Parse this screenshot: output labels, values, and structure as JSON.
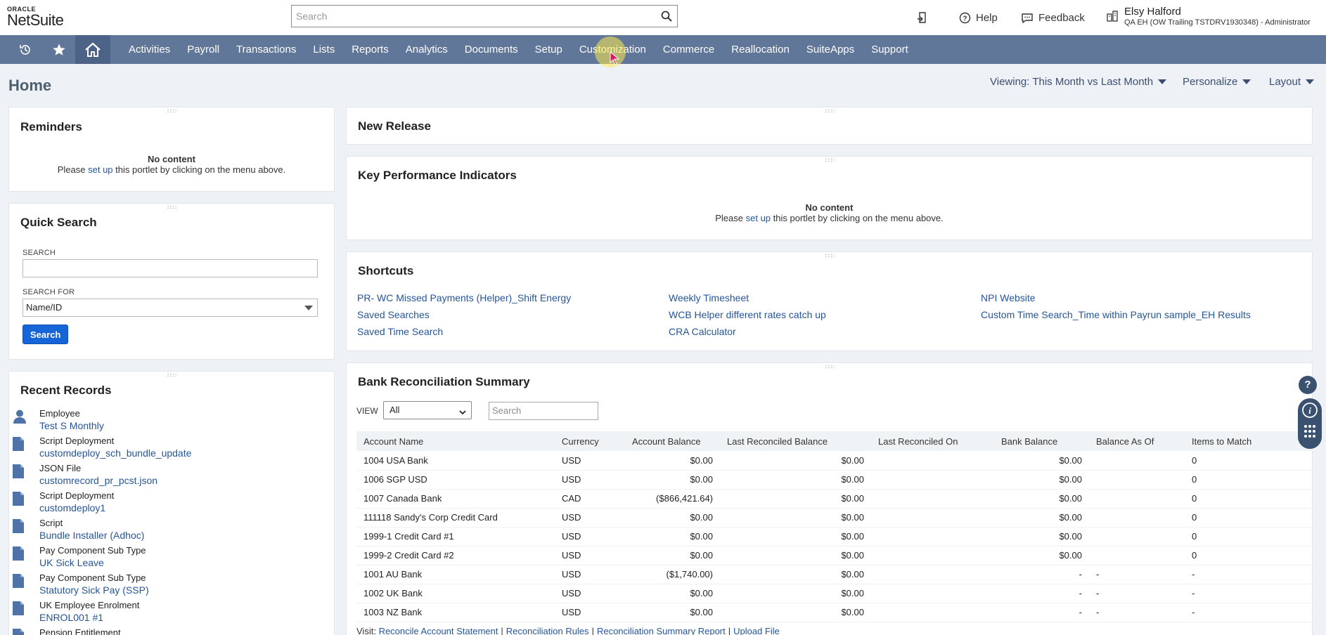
{
  "header": {
    "logo_top": "ORACLE",
    "logo_bottom": "NetSuite",
    "search_placeholder": "Search",
    "help_label": "Help",
    "feedback_label": "Feedback",
    "user_name": "Elsy Halford",
    "user_role": "QA EH (OW Trailing TSTDRV1930348) - Administrator"
  },
  "nav": {
    "items": [
      "Activities",
      "Payroll",
      "Transactions",
      "Lists",
      "Reports",
      "Analytics",
      "Documents",
      "Setup",
      "Customization",
      "Commerce",
      "Reallocation",
      "SuiteApps",
      "Support"
    ]
  },
  "page": {
    "title": "Home",
    "viewing_label": "Viewing: This Month vs Last Month",
    "personalize_label": "Personalize",
    "layout_label": "Layout"
  },
  "reminders": {
    "title": "Reminders",
    "no_content": "No content",
    "setup_pre": "Please ",
    "setup_link": "set up",
    "setup_post": " this portlet by clicking on the menu above."
  },
  "quick_search": {
    "title": "Quick Search",
    "search_label": "SEARCH",
    "search_for_label": "SEARCH FOR",
    "search_for_value": "Name/ID",
    "button_label": "Search"
  },
  "recent_records": {
    "title": "Recent Records",
    "items": [
      {
        "type": "Employee",
        "name": "Test S Monthly",
        "icon": "person-icon"
      },
      {
        "type": "Script Deployment",
        "name": "customdeploy_sch_bundle_update",
        "icon": "document-icon"
      },
      {
        "type": "JSON File",
        "name": "customrecord_pr_pcst.json",
        "icon": "document-icon"
      },
      {
        "type": "Script Deployment",
        "name": "customdeploy1",
        "icon": "document-icon"
      },
      {
        "type": "Script",
        "name": "Bundle Installer (Adhoc)",
        "icon": "document-icon"
      },
      {
        "type": "Pay Component Sub Type",
        "name": "UK Sick Leave",
        "icon": "document-icon"
      },
      {
        "type": "Pay Component Sub Type",
        "name": "Statutory Sick Pay (SSP)",
        "icon": "document-icon"
      },
      {
        "type": "UK Employee Enrolment",
        "name": "ENROL001 #1",
        "icon": "document-icon"
      },
      {
        "type": "Pension Entitlement",
        "name": "",
        "icon": "document-icon"
      }
    ]
  },
  "new_release": {
    "title": "New Release"
  },
  "kpi": {
    "title": "Key Performance Indicators",
    "no_content": "No content",
    "setup_pre": "Please ",
    "setup_link": "set up",
    "setup_post": " this portlet by clicking on the menu above."
  },
  "shortcuts": {
    "title": "Shortcuts",
    "links": [
      "PR- WC Missed Payments (Helper)_Shift Energy",
      "Saved Searches",
      "Saved Time Search",
      "Weekly Timesheet",
      "WCB Helper different rates catch up",
      "CRA Calculator",
      "NPI Website",
      "Custom Time Search_Time within Payrun sample_EH Results"
    ]
  },
  "bank_rec": {
    "title": "Bank Reconciliation Summary",
    "view_label": "VIEW",
    "view_value": "All",
    "search_placeholder": "Search",
    "columns": [
      "Account Name",
      "Currency",
      "Account Balance",
      "Last Reconciled Balance",
      "Last Reconciled On",
      "Bank Balance",
      "Balance As Of",
      "Items to Match"
    ],
    "rows": [
      [
        "1004 USA Bank",
        "USD",
        "$0.00",
        "$0.00",
        "",
        "$0.00",
        "",
        "0"
      ],
      [
        "1006 SGP USD",
        "USD",
        "$0.00",
        "$0.00",
        "",
        "$0.00",
        "",
        "0"
      ],
      [
        "1007 Canada Bank",
        "CAD",
        "($866,421.64)",
        "$0.00",
        "",
        "$0.00",
        "",
        "0"
      ],
      [
        "111118 Sandy's Corp Credit Card",
        "USD",
        "$0.00",
        "$0.00",
        "",
        "$0.00",
        "",
        "0"
      ],
      [
        "1999-1 Credit Card #1",
        "USD",
        "$0.00",
        "$0.00",
        "",
        "$0.00",
        "",
        "0"
      ],
      [
        "1999-2 Credit Card #2",
        "USD",
        "$0.00",
        "$0.00",
        "",
        "$0.00",
        "",
        "0"
      ],
      [
        "1001 AU Bank",
        "USD",
        "($1,740.00)",
        "$0.00",
        "",
        "-",
        "-",
        "-"
      ],
      [
        "1002 UK Bank",
        "USD",
        "$0.00",
        "$0.00",
        "",
        "-",
        "-",
        "-"
      ],
      [
        "1003 NZ Bank",
        "USD",
        "$0.00",
        "$0.00",
        "",
        "-",
        "-",
        "-"
      ]
    ],
    "visit_label": "Visit:",
    "visit_links": [
      "Reconcile Account Statement",
      "Reconciliation Rules",
      "Reconciliation Summary Report",
      "Upload File"
    ]
  },
  "side_widgets": {
    "help_glyph": "?"
  },
  "colors": {
    "nav_bg": "#607799",
    "link": "#255599",
    "button_blue": "#1565d8"
  }
}
